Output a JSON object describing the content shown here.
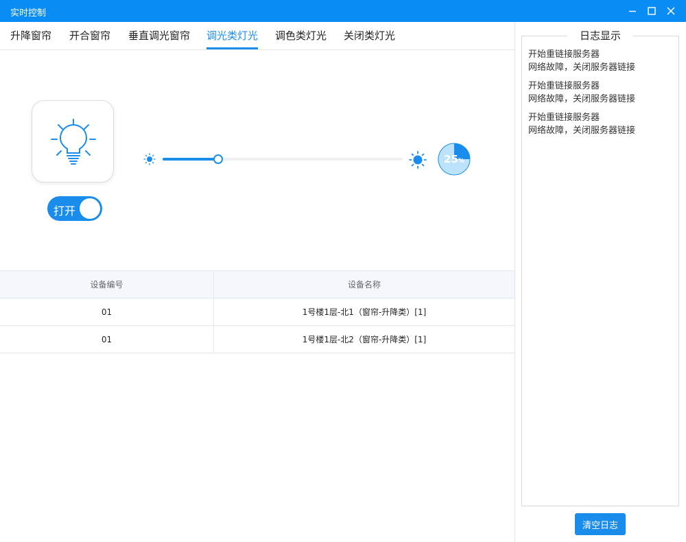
{
  "window": {
    "title": "实时控制",
    "icons": {
      "minimize": "minimize-icon",
      "maximize": "maximize-icon",
      "close": "close-icon"
    }
  },
  "tabs": [
    {
      "label": "升降窗帘",
      "active": false
    },
    {
      "label": "开合窗帘",
      "active": false
    },
    {
      "label": "垂直调光窗帘",
      "active": false
    },
    {
      "label": "调光类灯光",
      "active": true
    },
    {
      "label": "调色类灯光",
      "active": false
    },
    {
      "label": "关闭类灯光",
      "active": false
    }
  ],
  "device": {
    "icon": "light-bulb-icon",
    "toggle_label": "打开",
    "toggle_on": true
  },
  "brightness": {
    "value_fraction": 0.23,
    "gauge_value": "25",
    "gauge_unit": "%",
    "gauge_fraction": 0.25,
    "icon_low": "sun-small-icon",
    "icon_high": "sun-large-icon"
  },
  "table": {
    "headers": [
      "设备编号",
      "设备名称"
    ],
    "rows": [
      {
        "id": "01",
        "name": "1号楼1层-北1（窗帘-升降类）[1]"
      },
      {
        "id": "01",
        "name": "1号楼1层-北2（窗帘-升降类）[1]"
      }
    ]
  },
  "log": {
    "title": "日志显示",
    "entries": [
      "开始重链接服务器",
      "网络故障，关闭服务器链接",
      "开始重链接服务器",
      "网络故障，关闭服务器链接",
      "开始重链接服务器",
      "网络故障，关闭服务器链接"
    ],
    "clear_label": "清空日志"
  },
  "colors": {
    "accent": "#1a8ceb",
    "titlebar": "#0a8cf5",
    "gauge_light": "#bde3fc"
  }
}
